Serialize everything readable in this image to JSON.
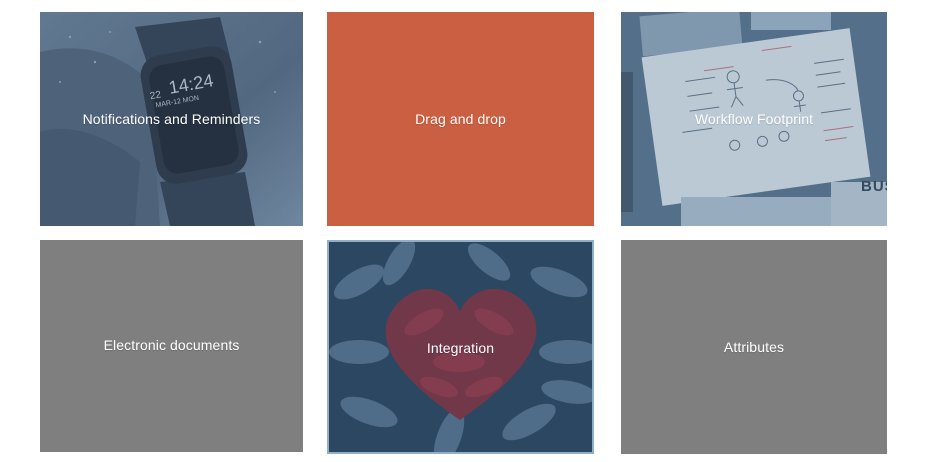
{
  "tiles": [
    {
      "label": "Notifications and Reminders",
      "icon": "smartwatch-photo",
      "color": "#5c6f86"
    },
    {
      "label": "Drag and drop",
      "icon": "none",
      "color": "#cb5f41"
    },
    {
      "label": "Workflow Footprint",
      "icon": "workflow-sketch-photo",
      "color": "#6e88a2"
    },
    {
      "label": "Electronic documents",
      "icon": "none",
      "color": "#7f7f7f"
    },
    {
      "label": "Integration",
      "icon": "painted-hands-heart-photo",
      "color": "#2f4a63"
    },
    {
      "label": "Attributes",
      "icon": "none",
      "color": "#7f7f7f"
    }
  ],
  "watch": {
    "time": "14:24",
    "day": "22",
    "date": "MAR-12 MON"
  },
  "sketch": {
    "sign_text": "BUS"
  }
}
